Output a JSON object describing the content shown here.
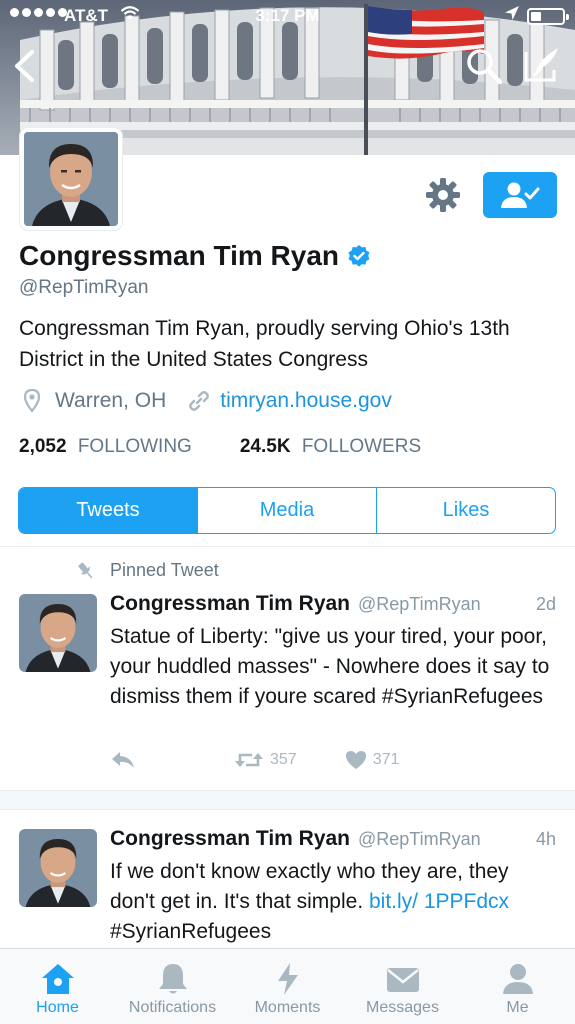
{
  "status_bar": {
    "carrier": "AT&T",
    "time": "3:17 PM"
  },
  "profile": {
    "name": "Congressman Tim Ryan",
    "handle": "@RepTimRyan",
    "bio": "Congressman Tim Ryan, proudly serving Ohio's 13th District in the United States Congress",
    "location": "Warren, OH",
    "website": "timryan.house.gov",
    "following_count": "2,052",
    "following_label": "FOLLOWING",
    "followers_count": "24.5K",
    "followers_label": "FOLLOWERS"
  },
  "tabs": [
    {
      "label": "Tweets",
      "active": true
    },
    {
      "label": "Media",
      "active": false
    },
    {
      "label": "Likes",
      "active": false
    }
  ],
  "pinned_label": "Pinned Tweet",
  "tweets": [
    {
      "name": "Congressman Tim Ryan",
      "handle": "@RepTimRyan",
      "time": "2d",
      "text": "Statue of Liberty: \"give us your tired, your poor, your huddled masses\" - Nowhere does it say to dismiss them if youre scared #SyrianRefugees",
      "retweets": "357",
      "likes": "371"
    },
    {
      "name": "Congressman Tim Ryan",
      "handle": "@RepTimRyan",
      "time": "4h",
      "text_before": "If we don't know exactly who they are, they don't get in. It's that simple. ",
      "link": "bit.ly/ 1PPFdcx",
      "text_after": " #SyrianRefugees"
    }
  ],
  "tabbar": [
    {
      "label": "Home",
      "icon": "home-icon",
      "active": true
    },
    {
      "label": "Notifications",
      "icon": "bell-icon",
      "active": false
    },
    {
      "label": "Moments",
      "icon": "lightning-icon",
      "active": false
    },
    {
      "label": "Messages",
      "icon": "envelope-icon",
      "active": false
    },
    {
      "label": "Me",
      "icon": "person-icon",
      "active": false
    }
  ],
  "colors": {
    "accent": "#1da1f2",
    "link": "#1b95e0",
    "muted": "#657786"
  }
}
